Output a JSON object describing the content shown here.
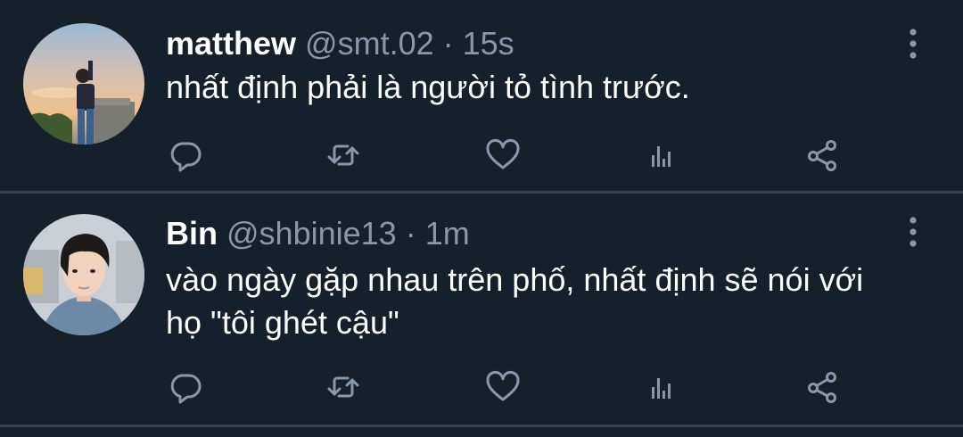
{
  "theme": {
    "background": "#15202b",
    "text": "#ffffff",
    "muted": "#8899a6",
    "divider": "#38444d"
  },
  "tweets": [
    {
      "display_name": "matthew",
      "handle": "@smt.02",
      "separator": " · ",
      "time": "15s",
      "text": "nhất định phải là người tỏ tình trước.",
      "avatar": "user-photo-avatar",
      "actions": [
        "reply-icon",
        "retweet-icon",
        "like-icon",
        "analytics-icon",
        "share-icon"
      ]
    },
    {
      "display_name": "Bin",
      "handle": "@shbinie13",
      "separator": " · ",
      "time": "1m",
      "text": "vào ngày gặp nhau trên phố, nhất định sẽ nói với họ \"tôi ghét cậu\"",
      "avatar": "user-photo-avatar",
      "actions": [
        "reply-icon",
        "retweet-icon",
        "like-icon",
        "analytics-icon",
        "share-icon"
      ]
    }
  ]
}
